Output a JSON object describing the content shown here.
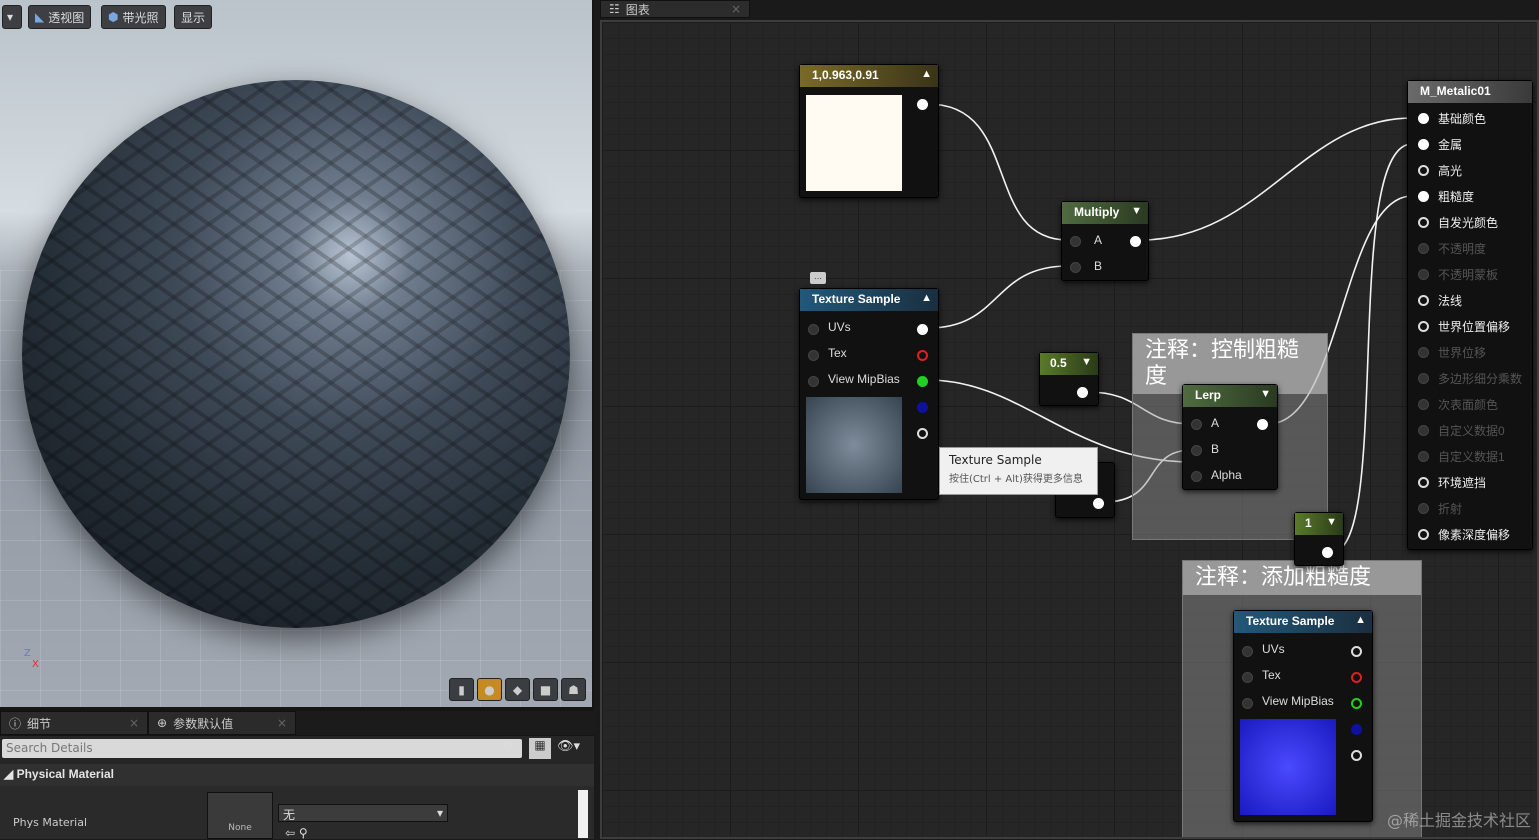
{
  "viewport": {
    "toolbar": {
      "menu_icon": "dropdown-icon",
      "perspective": "透视图",
      "lit": "带光照",
      "show": "显示"
    },
    "axis": {
      "z": "Z",
      "x": "X"
    }
  },
  "panel_tabs": [
    {
      "label": "细节"
    },
    {
      "label": "参数默认值"
    }
  ],
  "details": {
    "search_placeholder": "Search Details",
    "section": "Physical Material",
    "row_label": "Phys Material",
    "thumb_label": "None",
    "select_value": "无"
  },
  "graph": {
    "tab": "图表",
    "const3": {
      "title": "1,0.963,0.91"
    },
    "multiply": {
      "title": "Multiply",
      "pins": [
        "A",
        "B"
      ]
    },
    "texsample1": {
      "title": "Texture Sample",
      "pins": [
        "UVs",
        "Tex",
        "View MipBias"
      ]
    },
    "const_05": {
      "title": "0.5"
    },
    "const_1": {
      "title": "1"
    },
    "lerp": {
      "title": "Lerp",
      "pins": [
        "A",
        "B",
        "Alpha"
      ]
    },
    "comment1": "注释：控制粗糙度",
    "comment2": "注释：添加粗糙度",
    "texsample2": {
      "title": "Texture Sample",
      "pins": [
        "UVs",
        "Tex",
        "View MipBias"
      ]
    },
    "material": {
      "title": "M_Metalic01",
      "pins": [
        {
          "label": "基础颜色",
          "enabled": true
        },
        {
          "label": "金属",
          "enabled": true
        },
        {
          "label": "高光",
          "enabled": true
        },
        {
          "label": "粗糙度",
          "enabled": true
        },
        {
          "label": "自发光颜色",
          "enabled": true
        },
        {
          "label": "不透明度",
          "enabled": false
        },
        {
          "label": "不透明蒙板",
          "enabled": false
        },
        {
          "label": "法线",
          "enabled": true
        },
        {
          "label": "世界位置偏移",
          "enabled": true
        },
        {
          "label": "世界位移",
          "enabled": false
        },
        {
          "label": "多边形细分乘数",
          "enabled": false
        },
        {
          "label": "次表面颜色",
          "enabled": false
        },
        {
          "label": "自定义数据0",
          "enabled": false
        },
        {
          "label": "自定义数据1",
          "enabled": false
        },
        {
          "label": "环境遮挡",
          "enabled": true
        },
        {
          "label": "折射",
          "enabled": false
        },
        {
          "label": "像素深度偏移",
          "enabled": true
        }
      ]
    },
    "tooltip": {
      "title": "Texture Sample",
      "hint": "按住(Ctrl + Alt)获得更多信息"
    }
  },
  "watermark": "@稀土掘金技术社区"
}
